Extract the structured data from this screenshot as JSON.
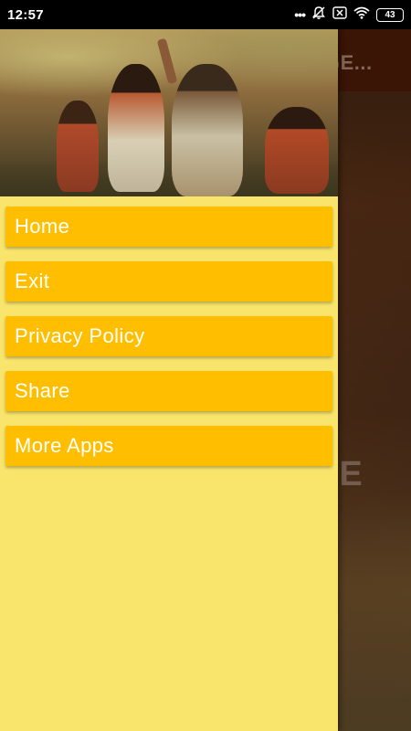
{
  "status_bar": {
    "time": "12:57",
    "more_indicator": "•••",
    "battery_level": "43"
  },
  "background_app": {
    "header_title_partial": "GE...",
    "body_text_partial": "VE"
  },
  "drawer": {
    "header_image": "painting of native american storytellers gathered outdoors",
    "menu_items": [
      {
        "label": "Home"
      },
      {
        "label": "Exit"
      },
      {
        "label": "Privacy Policy"
      },
      {
        "label": "Share"
      },
      {
        "label": "More Apps"
      }
    ]
  },
  "colors": {
    "drawer_bg": "#f9e56b",
    "menu_item_bg": "#ffbf00",
    "menu_text": "#ffffff",
    "status_bar_bg": "#000000",
    "app_header_bg": "#5a1f08"
  }
}
